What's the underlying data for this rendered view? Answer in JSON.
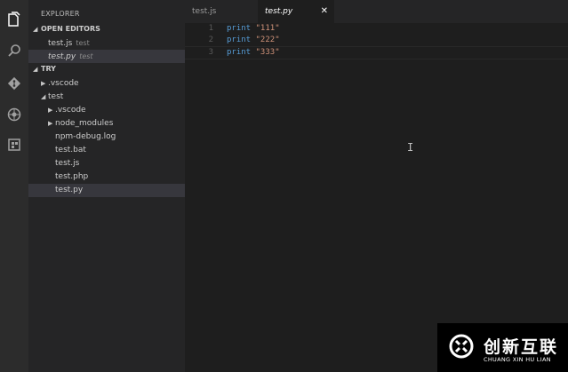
{
  "sidebar": {
    "title": "EXPLORER",
    "open_editors": {
      "label": "OPEN EDITORS",
      "items": [
        {
          "name": "test.js",
          "desc": "test"
        },
        {
          "name": "test.py",
          "desc": "test"
        }
      ]
    },
    "folder": {
      "label": "TRY",
      "items": [
        {
          "name": ".vscode"
        },
        {
          "name": "test"
        },
        {
          "name": ".vscode"
        },
        {
          "name": "node_modules"
        },
        {
          "name": "npm-debug.log"
        },
        {
          "name": "test.bat"
        },
        {
          "name": "test.js"
        },
        {
          "name": "test.php"
        },
        {
          "name": "test.py"
        }
      ]
    }
  },
  "tabs": [
    {
      "label": "test.js"
    },
    {
      "label": "test.py",
      "close": "✕"
    }
  ],
  "editor": {
    "lines": [
      {
        "num": "1",
        "kw": "print",
        "str": "\"111\""
      },
      {
        "num": "2",
        "kw": "print",
        "str": "\"222\""
      },
      {
        "num": "3",
        "kw": "print",
        "str": "\"333\""
      }
    ]
  },
  "watermark": {
    "cn": "创新互联",
    "en": "CHUANG XIN HU LIAN"
  },
  "colors": {
    "keyword": "#569cd6",
    "string": "#ce9178",
    "selection": "#37373d"
  },
  "icons": [
    "files-icon",
    "search-icon",
    "git-icon",
    "debug-icon",
    "extensions-icon"
  ]
}
